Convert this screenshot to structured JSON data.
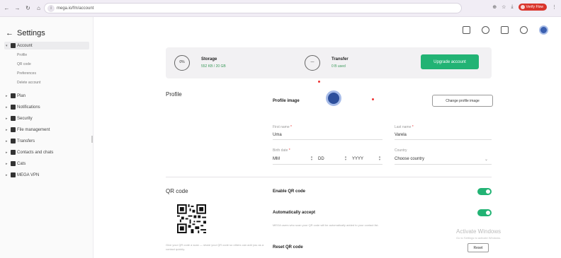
{
  "browser": {
    "url": "mega.io/fm/account",
    "user_label": "Verify Flow"
  },
  "sidebar": {
    "title": "Settings",
    "items": [
      {
        "label": "Account",
        "expanded": true
      },
      {
        "label": "Plan"
      },
      {
        "label": "Notifications"
      },
      {
        "label": "Security"
      },
      {
        "label": "File management"
      },
      {
        "label": "Transfers"
      },
      {
        "label": "Contacts and chats"
      },
      {
        "label": "Cats"
      },
      {
        "label": "MEGA VPN"
      }
    ],
    "subitems": [
      "Profile",
      "QR code",
      "Preferences",
      "Delete account"
    ]
  },
  "storage": {
    "percent": "0%",
    "storage_label": "Storage",
    "storage_value": "552 KB / 20 GB",
    "transfer_label": "Transfer",
    "transfer_value": "0 B used",
    "upgrade_label": "Upgrade account"
  },
  "profile": {
    "section_title": "Profile",
    "image_label": "Profile image",
    "change_label": "Change profile image",
    "first_name_label": "First name",
    "first_name": "Uma",
    "last_name_label": "Last name",
    "last_name": "Varela",
    "birth_label": "Birth date",
    "birth_mm": "MM",
    "birth_dd": "DD",
    "birth_yyyy": "YYYY",
    "country_label": "Country",
    "country_value": "Choose country"
  },
  "qr": {
    "section_title": "QR code",
    "enable_label": "Enable QR code",
    "auto_label": "Automatically accept",
    "auto_desc": "MEGA users who scan your QR code will be automatically added to your contact list.",
    "reset_label": "Reset QR code",
    "reset_button": "Reset",
    "desc": "Give your QR code a scan — share your QR code so others can add you as a contact quickly."
  },
  "watermark": {
    "title": "Activate Windows",
    "sub": "Go to Settings to activate Windows."
  },
  "colors": {
    "accent": "#22b374",
    "danger": "#e33333"
  }
}
